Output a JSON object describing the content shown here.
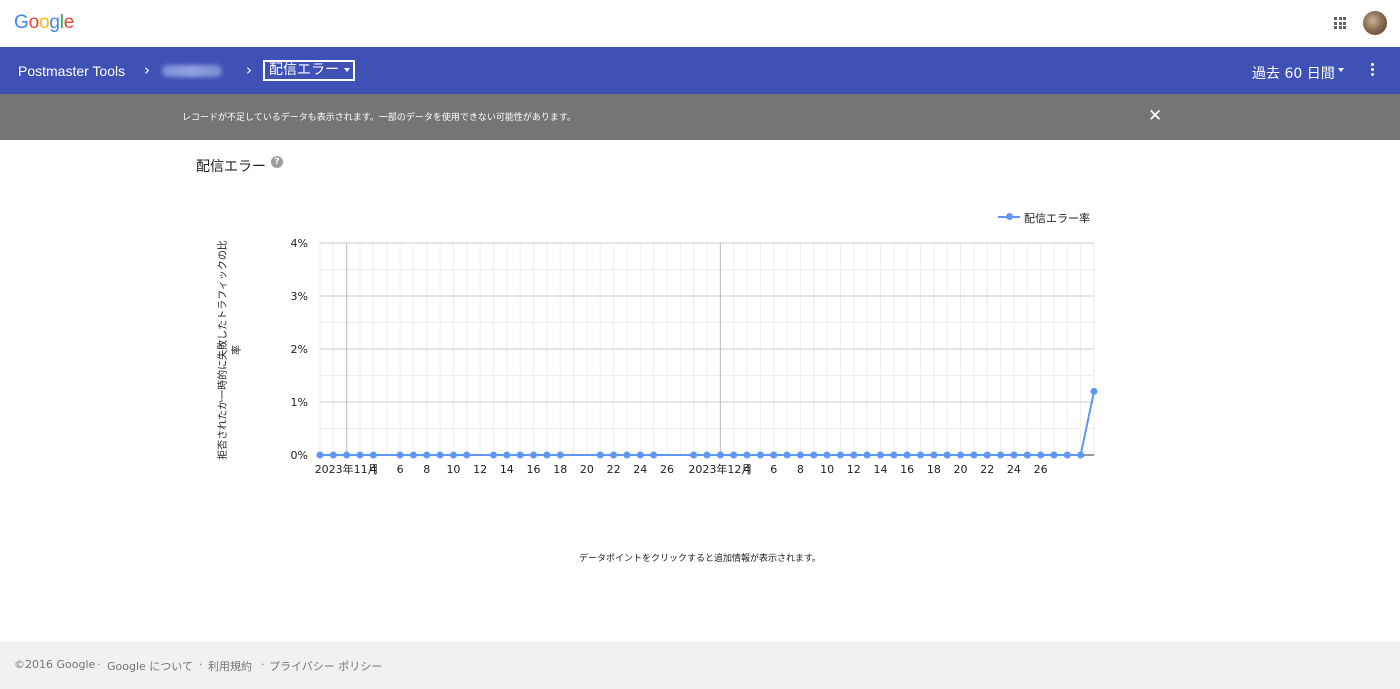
{
  "header": {
    "logo_letters": [
      {
        "char": "G",
        "color": "#4285f4"
      },
      {
        "char": "o",
        "color": "#ea4335"
      },
      {
        "char": "o",
        "color": "#fbbc05"
      },
      {
        "char": "g",
        "color": "#4285f4"
      },
      {
        "char": "l",
        "color": "#34a853"
      },
      {
        "char": "e",
        "color": "#ea4335"
      }
    ],
    "apps_icon": "apps-grid-icon",
    "avatar_icon": "user-avatar"
  },
  "nav": {
    "title": "Postmaster Tools",
    "separator": "›",
    "dashboard_label": "配信エラー",
    "period_label": "過去 60 日間",
    "bar_color": "#3f51b5"
  },
  "banner": {
    "text": "レコードが不足しているデータも表示されます。一部のデータを使用できない可能性があります。",
    "close_icon": "close-icon"
  },
  "section": {
    "title": "配信エラー",
    "help_icon": "?"
  },
  "chart_data": {
    "type": "line",
    "title": "",
    "ylabel": "拒否されたか一時的に失敗したトラフィックの比率",
    "ylim": [
      0,
      4
    ],
    "yticks": [
      "0%",
      "1%",
      "2%",
      "3%",
      "4%"
    ],
    "xlim": [
      0,
      56
    ],
    "xtick_labels": [
      {
        "x": 0.0,
        "label": "2023年11月"
      },
      {
        "x": 2.0,
        "label": "4"
      },
      {
        "x": 4.0,
        "label": "6"
      },
      {
        "x": 6.0,
        "label": "8"
      },
      {
        "x": 8.0,
        "label": "10"
      },
      {
        "x": 10.0,
        "label": "12"
      },
      {
        "x": 12.0,
        "label": "14"
      },
      {
        "x": 14.0,
        "label": "16"
      },
      {
        "x": 16.0,
        "label": "18"
      },
      {
        "x": 18.0,
        "label": "20"
      },
      {
        "x": 20.0,
        "label": "22"
      },
      {
        "x": 22.0,
        "label": "24"
      },
      {
        "x": 24.0,
        "label": "26"
      },
      {
        "x": 28.0,
        "label": "2023年12月"
      },
      {
        "x": 30.0,
        "label": "4"
      },
      {
        "x": 32.0,
        "label": "6"
      },
      {
        "x": 34.0,
        "label": "8"
      },
      {
        "x": 36.0,
        "label": "10"
      },
      {
        "x": 38.0,
        "label": "12"
      },
      {
        "x": 40.0,
        "label": "14"
      },
      {
        "x": 42.0,
        "label": "16"
      },
      {
        "x": 44.0,
        "label": "18"
      },
      {
        "x": 46.0,
        "label": "20"
      },
      {
        "x": 48.0,
        "label": "22"
      },
      {
        "x": 50.0,
        "label": "24"
      },
      {
        "x": 52.0,
        "label": "26"
      }
    ],
    "series": [
      {
        "name": "配信エラー率",
        "color": "#5e97f6",
        "points": [
          [
            -2,
            0
          ],
          [
            -1,
            0
          ],
          [
            0,
            0
          ],
          [
            1,
            0
          ],
          [
            2,
            0
          ],
          [
            4,
            0
          ],
          [
            5,
            0
          ],
          [
            6,
            0
          ],
          [
            7,
            0
          ],
          [
            8,
            0
          ],
          [
            9,
            0
          ],
          [
            11,
            0
          ],
          [
            12,
            0
          ],
          [
            13,
            0
          ],
          [
            14,
            0
          ],
          [
            15,
            0
          ],
          [
            16,
            0
          ],
          [
            19,
            0
          ],
          [
            20,
            0
          ],
          [
            21,
            0
          ],
          [
            22,
            0
          ],
          [
            23,
            0
          ],
          [
            26,
            0
          ],
          [
            27,
            0
          ],
          [
            28,
            0
          ],
          [
            29,
            0
          ],
          [
            30,
            0
          ],
          [
            31,
            0
          ],
          [
            32,
            0
          ],
          [
            33,
            0
          ],
          [
            34,
            0
          ],
          [
            35,
            0
          ],
          [
            36,
            0
          ],
          [
            37,
            0
          ],
          [
            38,
            0
          ],
          [
            39,
            0
          ],
          [
            40,
            0
          ],
          [
            41,
            0
          ],
          [
            42,
            0
          ],
          [
            43,
            0
          ],
          [
            44,
            0
          ],
          [
            45,
            0
          ],
          [
            46,
            0
          ],
          [
            47,
            0
          ],
          [
            48,
            0
          ],
          [
            49,
            0
          ],
          [
            50,
            0
          ],
          [
            51,
            0
          ],
          [
            52,
            0
          ],
          [
            53,
            0
          ],
          [
            54,
            0
          ],
          [
            55,
            0
          ],
          [
            56,
            1.2
          ]
        ]
      }
    ],
    "grid": true,
    "legend": "top-right"
  },
  "hint": "データポイントをクリックすると追加情報が表示されます。",
  "footer": {
    "copyright": "©2016 Google",
    "links": [
      "Google について",
      "利用規約",
      "プライバシー ポリシー"
    ],
    "separator": "·"
  }
}
